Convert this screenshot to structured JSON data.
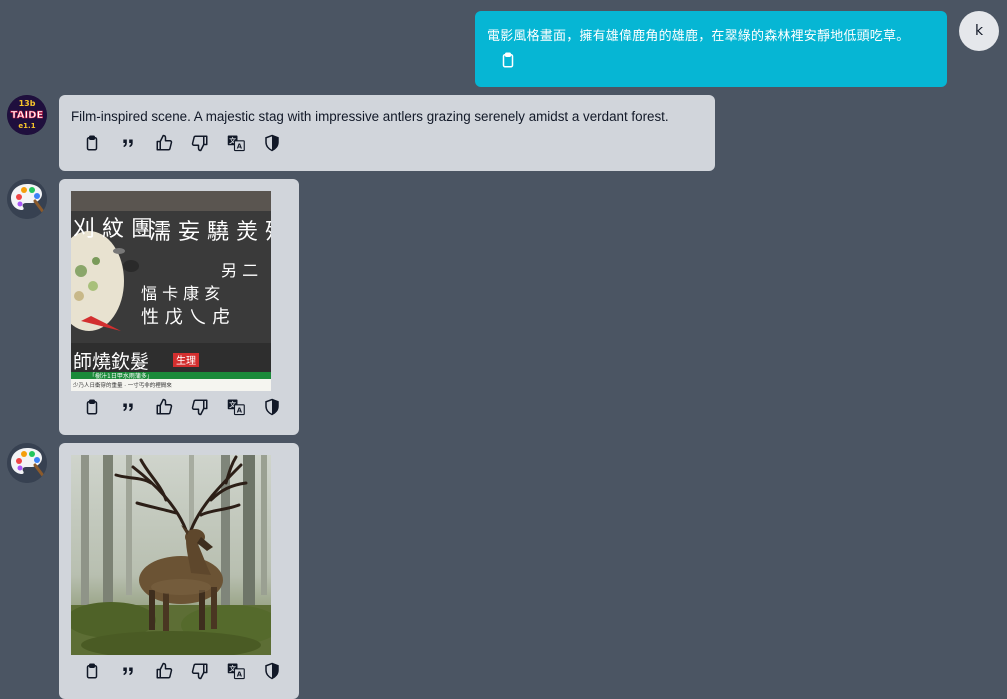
{
  "user": {
    "avatar_letter": "k",
    "message": "電影風格畫面，擁有雄偉鹿角的雄鹿，在翠綠的森林裡安靜地低頭吃草。"
  },
  "assistant": {
    "avatar_label_top": "13b",
    "avatar_label_mid": "TAIDE",
    "avatar_label_bottom": "e1.1",
    "message": "Film-inspired scene. A majestic stag with impressive antlers grazing serenely amidst a verdant forest."
  },
  "image_messages": [
    {
      "caption_main": "師燒欽髮",
      "caption_badge": "生理",
      "caption_line1": "「樹汁1日甲水雨蒲多」",
      "caption_line2": "少乃人日衝穿的重量 · 一寸丐非的裡間來"
    },
    {
      "caption_main": ""
    }
  ],
  "action_icons": [
    "copy-icon",
    "quote-icon",
    "thumbs-up-icon",
    "thumbs-down-icon",
    "translate-icon",
    "shield-icon"
  ],
  "colors": {
    "background": "#4b5563",
    "user_bubble": "#06b6d4",
    "assistant_card": "#d1d5db"
  }
}
